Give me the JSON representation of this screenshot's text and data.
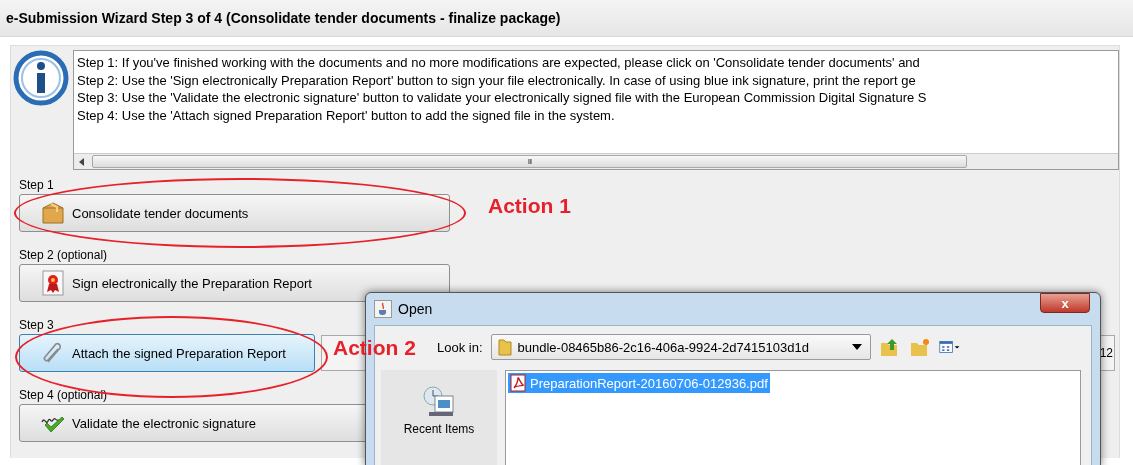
{
  "window": {
    "title": "e-Submission Wizard Step 3 of 4 (Consolidate tender documents - finalize package)"
  },
  "info": {
    "lines": [
      "Step 1: If you've finished working with the documents and no more modifications are expected, please click on 'Consolidate tender documents' and",
      "Step 2: Use the  'Sign electronically Preparation Report' button to sign your file electronically. In case of using blue ink signature, print the report ge",
      "Step 3: Use the 'Validate the electronic signature' button to validate your electronically signed file with the European Commission Digital Signature S",
      "Step 4: Use the 'Attach signed Preparation Report' button to add the signed file in the system."
    ],
    "scroll_grip": "III"
  },
  "steps": [
    {
      "label": "Step 1",
      "button": "Consolidate tender documents",
      "kind": "package",
      "highlighted": false,
      "annotation": "Action 1"
    },
    {
      "label": "Step 2 (optional)",
      "button": "Sign electronically the Preparation Report",
      "kind": "certificate",
      "highlighted": false
    },
    {
      "label": "Step 3",
      "button": "Attach the signed Preparation Report",
      "kind": "paperclip",
      "highlighted": true,
      "annotation": "Action 2",
      "side_field": true,
      "column_3": "12"
    },
    {
      "label": "Step 4 (optional)",
      "button": "Validate the electronic signature",
      "kind": "signature",
      "highlighted": false
    }
  ],
  "dialog": {
    "title": "Open",
    "close": "x",
    "look_in_label": "Look in:",
    "look_in_value": "bundle-08465b86-2c16-406a-9924-2d7415103d1d",
    "places": [
      {
        "label": "Recent Items"
      }
    ],
    "files": [
      {
        "name": "PreparationReport-20160706-012936.pdf",
        "selected": true
      }
    ]
  }
}
